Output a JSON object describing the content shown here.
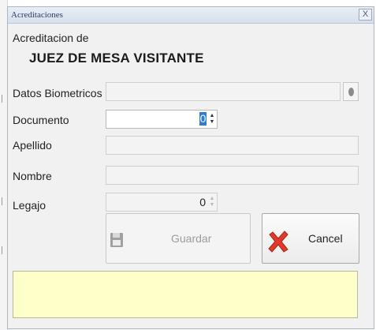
{
  "window": {
    "title": "Acreditaciones",
    "close_label": "X"
  },
  "header": {
    "subtitle": "Acreditacion de",
    "role": "JUEZ DE MESA VISITANTE"
  },
  "form": {
    "biometric_label": "Datos Biometricos",
    "biometric_value": "",
    "document_label": "Documento",
    "document_value": "0",
    "surname_label": "Apellido",
    "surname_value": "",
    "name_label": "Nombre",
    "name_value": "",
    "legajo_label": "Legajo",
    "legajo_value": "0"
  },
  "buttons": {
    "save_label": "Guardar",
    "save_icon": "floppy-disk-icon",
    "cancel_label": "Cancel",
    "cancel_icon": "red-x-icon"
  },
  "message": "",
  "colors": {
    "message_bg": "#ffffc9",
    "cancel_icon": "#e03a2a",
    "focus_caret": "#2f7bd6"
  }
}
